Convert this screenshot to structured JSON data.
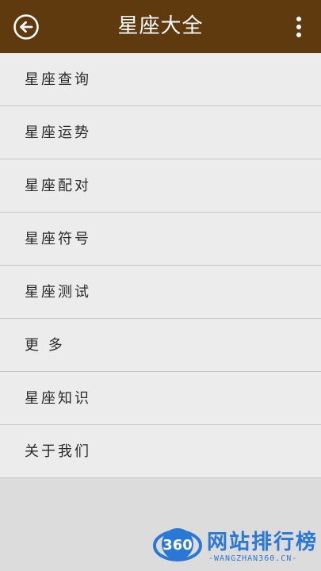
{
  "header": {
    "title": "星座大全",
    "back_icon": "arrow-left-circle-icon",
    "more_icon": "more-vertical-icon",
    "bg_color": "#5e3a0e"
  },
  "menu": {
    "items": [
      {
        "label": "星座查询"
      },
      {
        "label": "星座运势"
      },
      {
        "label": "星座配对"
      },
      {
        "label": "星座符号"
      },
      {
        "label": "星座测试"
      },
      {
        "label": "更 多"
      },
      {
        "label": "星座知识"
      },
      {
        "label": "关于我们"
      }
    ]
  },
  "watermark": {
    "badge_text": "360",
    "title": "网站排行榜",
    "subtitle": "-WANGZHAN360.CN-",
    "color": "#2a78d6"
  }
}
